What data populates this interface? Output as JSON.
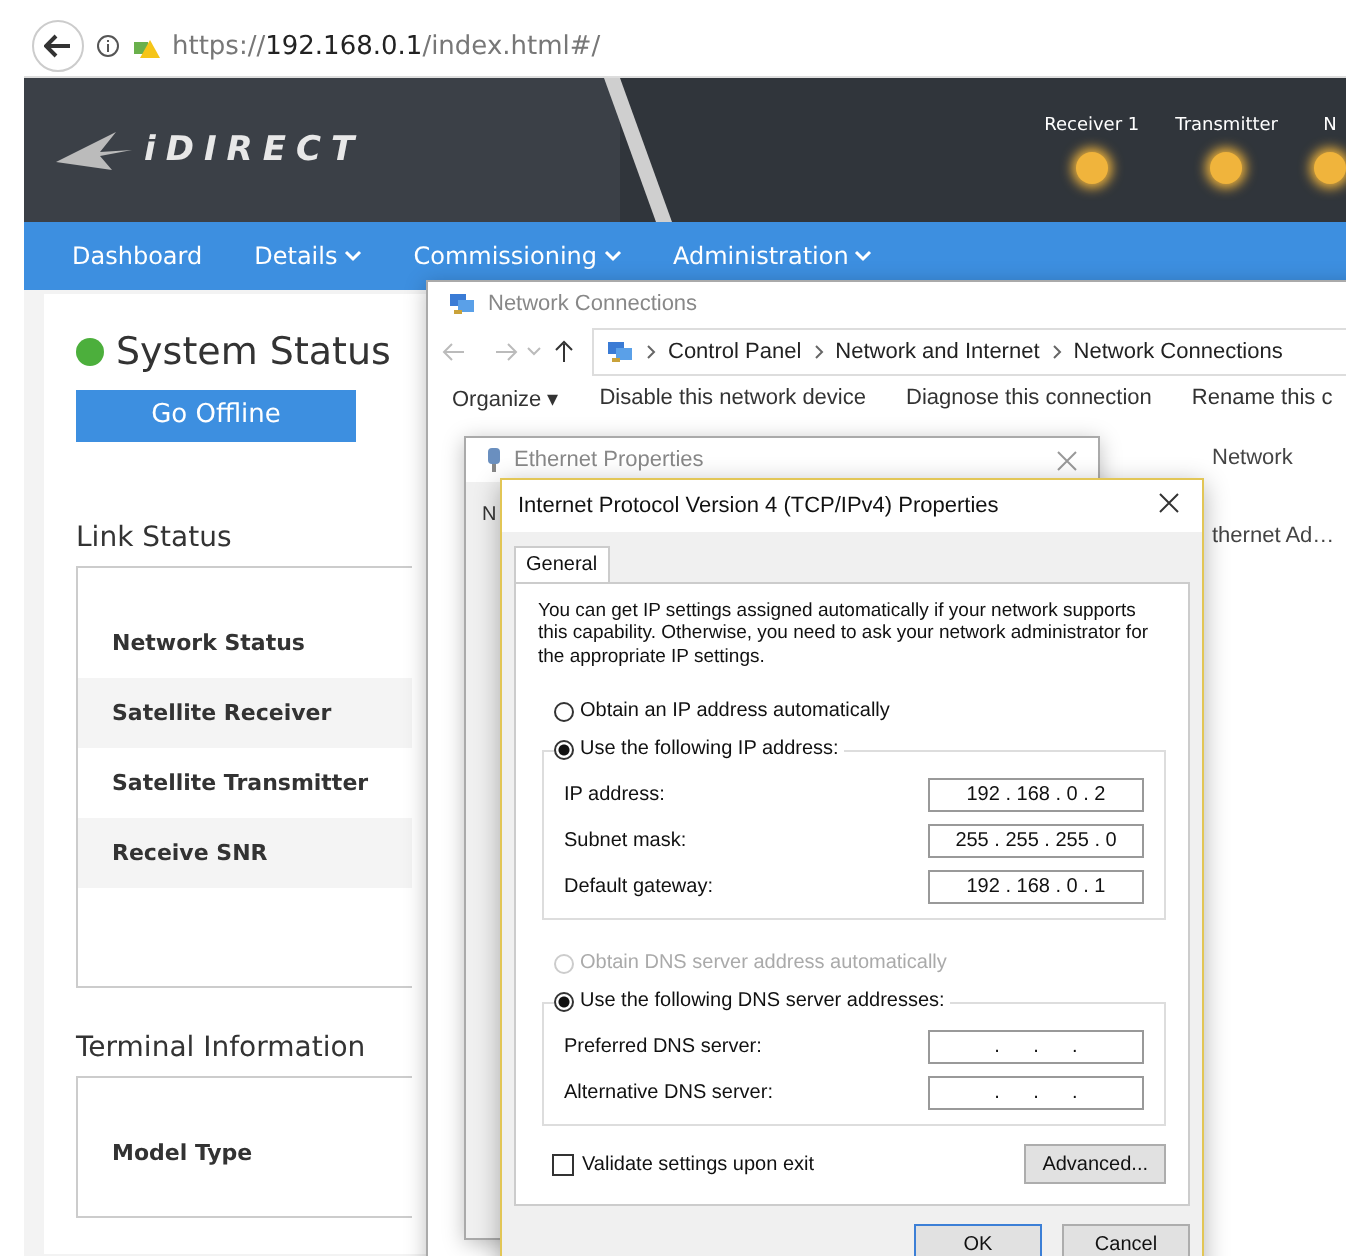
{
  "browser": {
    "url_prefix": "https://",
    "url_host": "192.168.0.1",
    "url_path": "/index.html#/"
  },
  "header": {
    "logo": "iDIRECT",
    "indicators": [
      {
        "label": "Receiver 1"
      },
      {
        "label": "Transmitter"
      },
      {
        "label": "N"
      }
    ]
  },
  "nav": [
    {
      "label": "Dashboard",
      "dropdown": false
    },
    {
      "label": "Details",
      "dropdown": true
    },
    {
      "label": "Commissioning",
      "dropdown": true
    },
    {
      "label": "Administration",
      "dropdown": true
    }
  ],
  "dashboard": {
    "status_title": "System Status",
    "go_offline": "Go Offline",
    "link_status": {
      "title": "Link Status",
      "rows": [
        "Network Status",
        "Satellite Receiver",
        "Satellite Transmitter",
        "Receive SNR"
      ]
    },
    "terminal": {
      "title": "Terminal Information",
      "rows": [
        "Model Type"
      ]
    }
  },
  "network_connections": {
    "title": "Network Connections",
    "breadcrumb": [
      "Control Panel",
      "Network and Internet",
      "Network Connections"
    ],
    "toolbar": [
      "Organize ▾",
      "Disable this network device",
      "Diagnose this connection",
      "Rename this c"
    ],
    "items": [
      "Network",
      "thernet Ad…"
    ]
  },
  "ethernet_properties": {
    "title": "Ethernet Properties",
    "partial_text": "N"
  },
  "ipv4": {
    "title": "Internet Protocol Version 4 (TCP/IPv4) Properties",
    "tabs": [
      {
        "label": "General",
        "selected": true
      }
    ],
    "intro": "You can get IP settings assigned automatically if your network supports this capability. Otherwise, you need to ask your network administrator for the appropriate IP settings.",
    "ip_options": [
      {
        "label": "Obtain an IP address automatically",
        "selected": false,
        "disabled": false
      },
      {
        "label": "Use the following IP address:",
        "selected": true,
        "disabled": false
      }
    ],
    "ip_fields": [
      {
        "label": "IP address:",
        "value": "192 . 168 . 0 . 2"
      },
      {
        "label": "Subnet mask:",
        "value": "255 . 255 . 255 . 0"
      },
      {
        "label": "Default gateway:",
        "value": "192 . 168 . 0 . 1"
      }
    ],
    "dns_options": [
      {
        "label": "Obtain DNS server address automatically",
        "selected": false,
        "disabled": true
      },
      {
        "label": "Use the following DNS server addresses:",
        "selected": true,
        "disabled": false
      }
    ],
    "dns_fields": [
      {
        "label": "Preferred DNS server:",
        "value": ".      .      ."
      },
      {
        "label": "Alternative DNS server:",
        "value": ".      .      ."
      }
    ],
    "validate": {
      "label": "Validate settings upon exit",
      "checked": false
    },
    "advanced": "Advanced...",
    "ok": "OK",
    "cancel": "Cancel"
  }
}
